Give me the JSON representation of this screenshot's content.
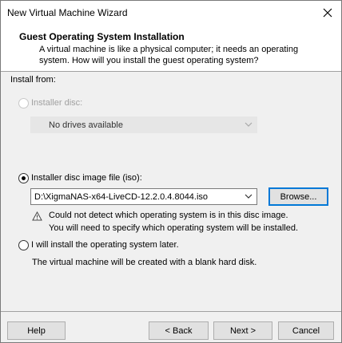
{
  "window": {
    "title": "New Virtual Machine Wizard"
  },
  "header": {
    "title": "Guest Operating System Installation",
    "description": "A virtual machine is like a physical computer; it needs an operating system. How will you install the guest operating system?"
  },
  "install_from": {
    "label": "Install from:",
    "installer_disc": {
      "label": "Installer disc:",
      "selected": false,
      "enabled": false,
      "drive_value": "No drives available"
    },
    "iso": {
      "label": "Installer disc image file (iso):",
      "selected": true,
      "path": "D:\\XigmaNAS-x64-LiveCD-12.2.0.4.8044.iso",
      "browse_label": "Browse...",
      "warning_line1": "Could not detect which operating system is in this disc image.",
      "warning_line2": "You will need to specify which operating system will be installed."
    },
    "later": {
      "label": "I will install the operating system later.",
      "selected": false,
      "note": "The virtual machine will be created with a blank hard disk."
    }
  },
  "buttons": {
    "help": "Help",
    "back": "< Back",
    "next": "Next >",
    "cancel": "Cancel"
  },
  "icons": {
    "close": "close-icon",
    "warning": "warning-icon",
    "chevron": "chevron-down-icon"
  }
}
